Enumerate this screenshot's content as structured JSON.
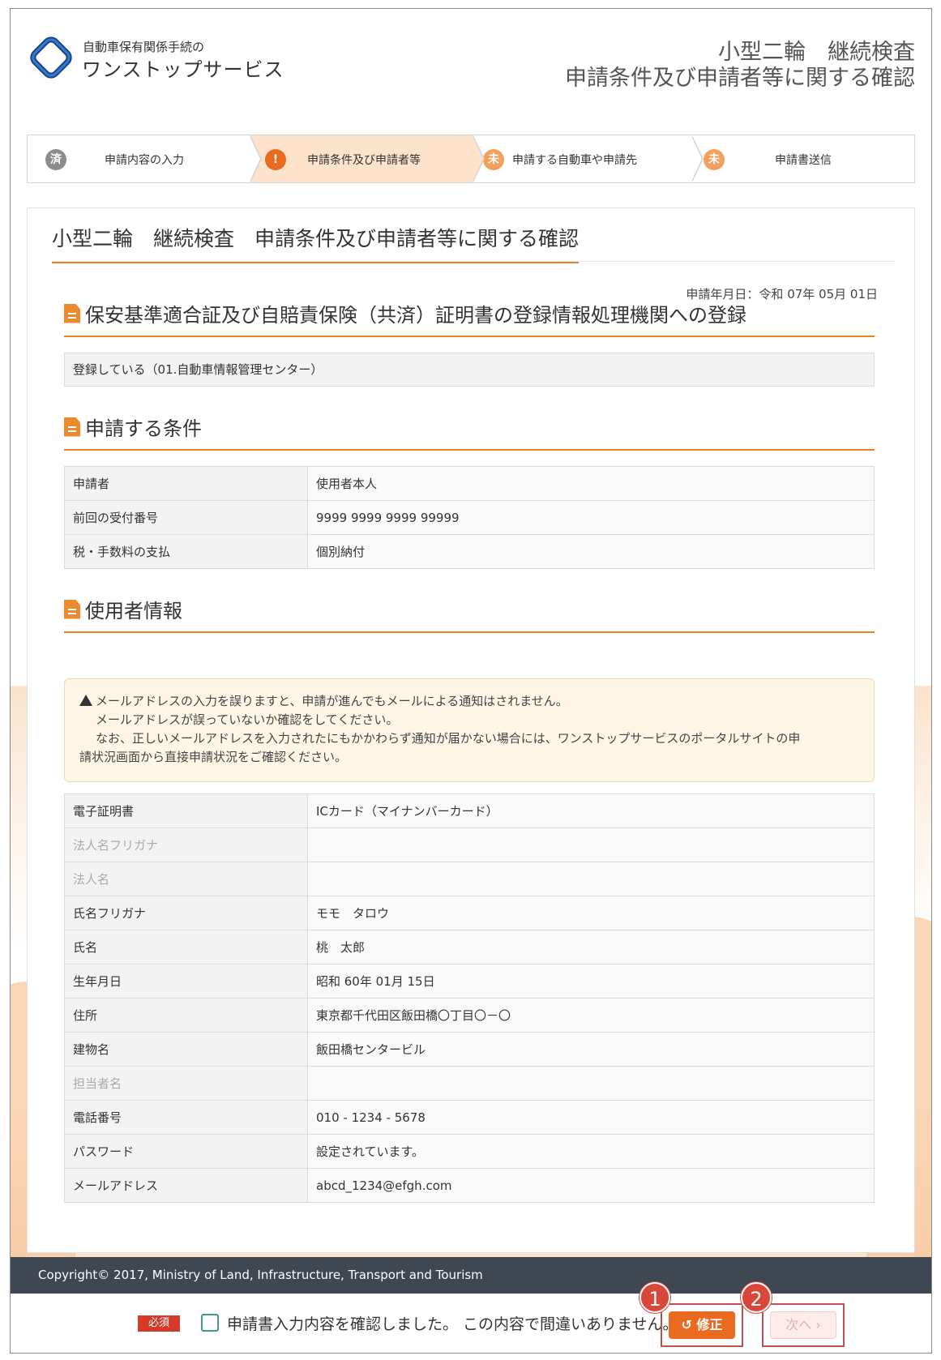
{
  "header": {
    "logo_small": "自動車保有関係手続の",
    "logo_big": "ワンストップサービス",
    "title_line1": "小型二輪　継続検査",
    "title_line2": "申請条件及び申請者等に関する確認"
  },
  "steps": [
    {
      "icon": "済",
      "label": "申請内容の入力",
      "icon_color": "#8c8c8c"
    },
    {
      "icon": "!",
      "label": "申請条件及び申請者等",
      "icon_color": "#ea6a1f"
    },
    {
      "icon": "未",
      "label": "申請する自動車や申請先",
      "icon_color": "#f3a05a"
    },
    {
      "icon": "未",
      "label": "申請書送信",
      "icon_color": "#f3a05a"
    }
  ],
  "page": {
    "title": "小型二輪　継続検査　申請条件及び申請者等に関する確認",
    "application_date": "申請年月日：令和 07年 05月 01日"
  },
  "section_registration": {
    "heading": "保安基準適合証及び自賠責保険（共済）証明書の登録情報処理機関への登録",
    "value": "登録している（01.自動車情報管理センター）"
  },
  "section_conditions": {
    "heading": "申請する条件",
    "rows": [
      {
        "label": "申請者",
        "value": "使用者本人"
      },
      {
        "label": "前回の受付番号",
        "value": "9999 9999 9999 99999"
      },
      {
        "label": "税・手数料の支払",
        "value": "個別納付"
      }
    ]
  },
  "section_user": {
    "heading": "使用者情報",
    "warning_line1": "メールアドレスの入力を誤りますと、申請が進んでもメールによる通知はされません。",
    "warning_line2": "メールアドレスが誤っていないか確認をしてください。",
    "warning_line3": "なお、正しいメールアドレスを入力されたにもかかわらず通知が届かない場合には、ワンストップサービスのポータルサイトの申",
    "warning_line4": "請状況画面から直接申請状況をご確認ください。",
    "rows": [
      {
        "label": "電子証明書",
        "value": "ICカード（マイナンバーカード）",
        "dim": false
      },
      {
        "label": "法人名フリガナ",
        "value": "",
        "dim": true
      },
      {
        "label": "法人名",
        "value": "",
        "dim": true
      },
      {
        "label": "氏名フリガナ",
        "value": "モモ　タロウ",
        "dim": false
      },
      {
        "label": "氏名",
        "value": "桃　太郎",
        "dim": false
      },
      {
        "label": "生年月日",
        "value": "昭和 60年 01月 15日",
        "dim": false
      },
      {
        "label": "住所",
        "value": "東京都千代田区飯田橋〇丁目〇－〇",
        "dim": false
      },
      {
        "label": "建物名",
        "value": "飯田橋センタービル",
        "dim": false
      },
      {
        "label": "担当者名",
        "value": "",
        "dim": true
      },
      {
        "label": "電話番号",
        "value": "010 - 1234 - 5678",
        "dim": false
      },
      {
        "label": "パスワード",
        "value": "設定されています。",
        "dim": false
      },
      {
        "label": "メールアドレス",
        "value": "abcd_1234@efgh.com",
        "dim": false
      }
    ]
  },
  "footer": {
    "copyright": "Copyright© 2017, Ministry of Land, Infrastructure, Transport and Tourism"
  },
  "confirm": {
    "required_badge": "必須",
    "text": "申請書入力内容を確認しました。 この内容で間違いありません。",
    "fix_label": "修正",
    "next_label": "次へ",
    "marker1": "1",
    "marker2": "2"
  },
  "colors": {
    "accent": "#e8822a",
    "footer_bg": "#3f4753",
    "fix_button": "#ea6a1f",
    "required": "#d43a2a"
  }
}
